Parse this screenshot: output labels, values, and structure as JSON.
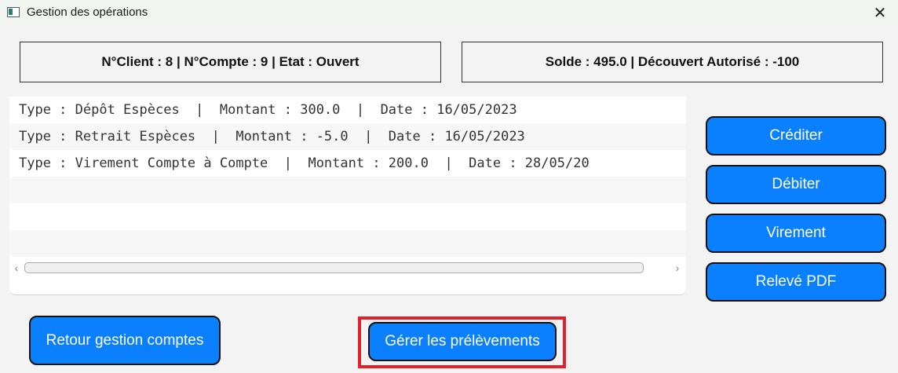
{
  "window": {
    "title": "Gestion des opérations",
    "close_glyph": "✕"
  },
  "info": {
    "client": "N°Client : 8 | N°Compte : 9 | Etat : Ouvert",
    "balance": "Solde : 495.0 | Découvert Autorisé : -100"
  },
  "operations": [
    "Type : Dépôt Espèces  |  Montant : 300.0  |  Date : 16/05/2023",
    "Type : Retrait Espèces  |  Montant : -5.0  |  Date : 16/05/2023",
    "Type : Virement Compte à Compte  |  Montant : 200.0  |  Date : 28/05/20"
  ],
  "scrollbar": {
    "left_arrow": "‹",
    "right_arrow": "›"
  },
  "actions": {
    "crediter": "Créditer",
    "debiter": "Débiter",
    "virement": "Virement",
    "releve": "Relevé PDF",
    "retour": "Retour gestion comptes",
    "prelevements": "Gérer les prélèvements"
  },
  "colors": {
    "button": "#0b80ff",
    "highlight": "#e0202c"
  }
}
